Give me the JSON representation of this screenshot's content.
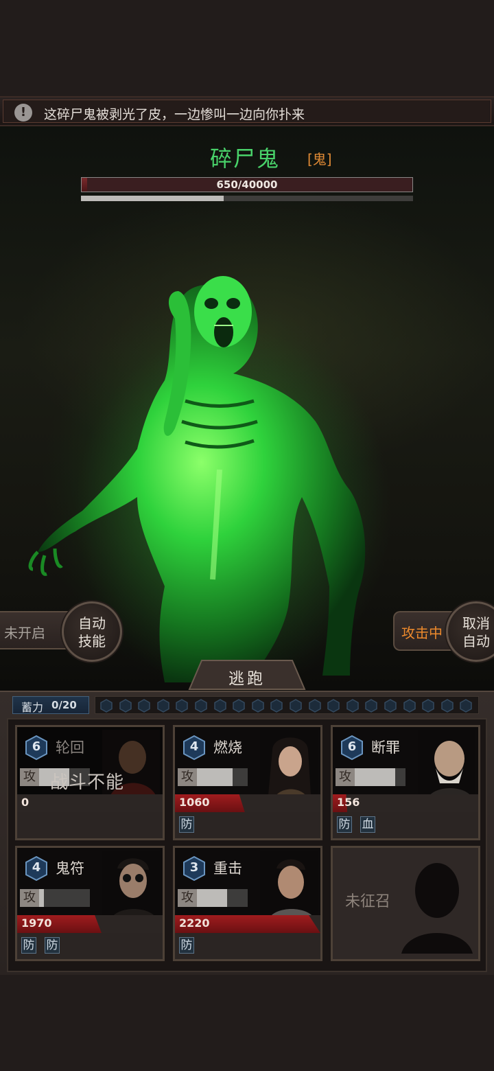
{
  "notification": {
    "icon": "info-icon",
    "icon_glyph": "!",
    "text": "这碎尸鬼被剥光了皮，一边惨叫一边向你扑来"
  },
  "boss": {
    "name": "碎尸鬼",
    "type_tag": "[鬼]",
    "hp_text": "650/40000",
    "hp_current": 650,
    "hp_max": 40000,
    "secondary_progress": 0.43,
    "name_color": "#49d26a",
    "tag_color": "#e08a35"
  },
  "controls": {
    "left_status": "未开启",
    "auto_skill_label_line1": "自动",
    "auto_skill_label_line2": "技能",
    "right_status": "攻击中",
    "cancel_auto_line1": "取消",
    "cancel_auto_line2": "自动",
    "flee_label": "逃跑",
    "attacking_color": "#ee8a2c"
  },
  "power": {
    "label": "蓄力",
    "value": "0/20",
    "slot_count": 20
  },
  "heroes": [
    {
      "level": "6",
      "skill": "轮回",
      "atk_icon": "攻",
      "atk_progress": 0.6,
      "hp": "0",
      "hp_fraction": 0.0,
      "badges": [],
      "disabled_text": "战斗不能",
      "portrait": "monk-portrait"
    },
    {
      "level": "4",
      "skill": "燃烧",
      "atk_icon": "攻",
      "atk_progress": 0.7,
      "hp": "1060",
      "hp_fraction": 0.48,
      "badges": [
        "防"
      ],
      "portrait": "girl-portrait"
    },
    {
      "level": "6",
      "skill": "断罪",
      "atk_icon": "攻",
      "atk_progress": 0.8,
      "hp": "156",
      "hp_fraction": 0.1,
      "badges": [
        "防",
        "血"
      ],
      "portrait": "old-man-portrait"
    },
    {
      "level": "4",
      "skill": "鬼符",
      "atk_icon": "攻",
      "atk_progress": 0.1,
      "hp": "1970",
      "hp_fraction": 0.58,
      "badges": [
        "防",
        "防"
      ],
      "portrait": "sunglasses-man-portrait"
    },
    {
      "level": "3",
      "skill": "重击",
      "atk_icon": "攻",
      "atk_progress": 0.6,
      "hp": "2220",
      "hp_fraction": 1.0,
      "badges": [
        "防"
      ],
      "portrait": "young-man-portrait"
    }
  ],
  "empty_slot": {
    "label": "未征召"
  }
}
